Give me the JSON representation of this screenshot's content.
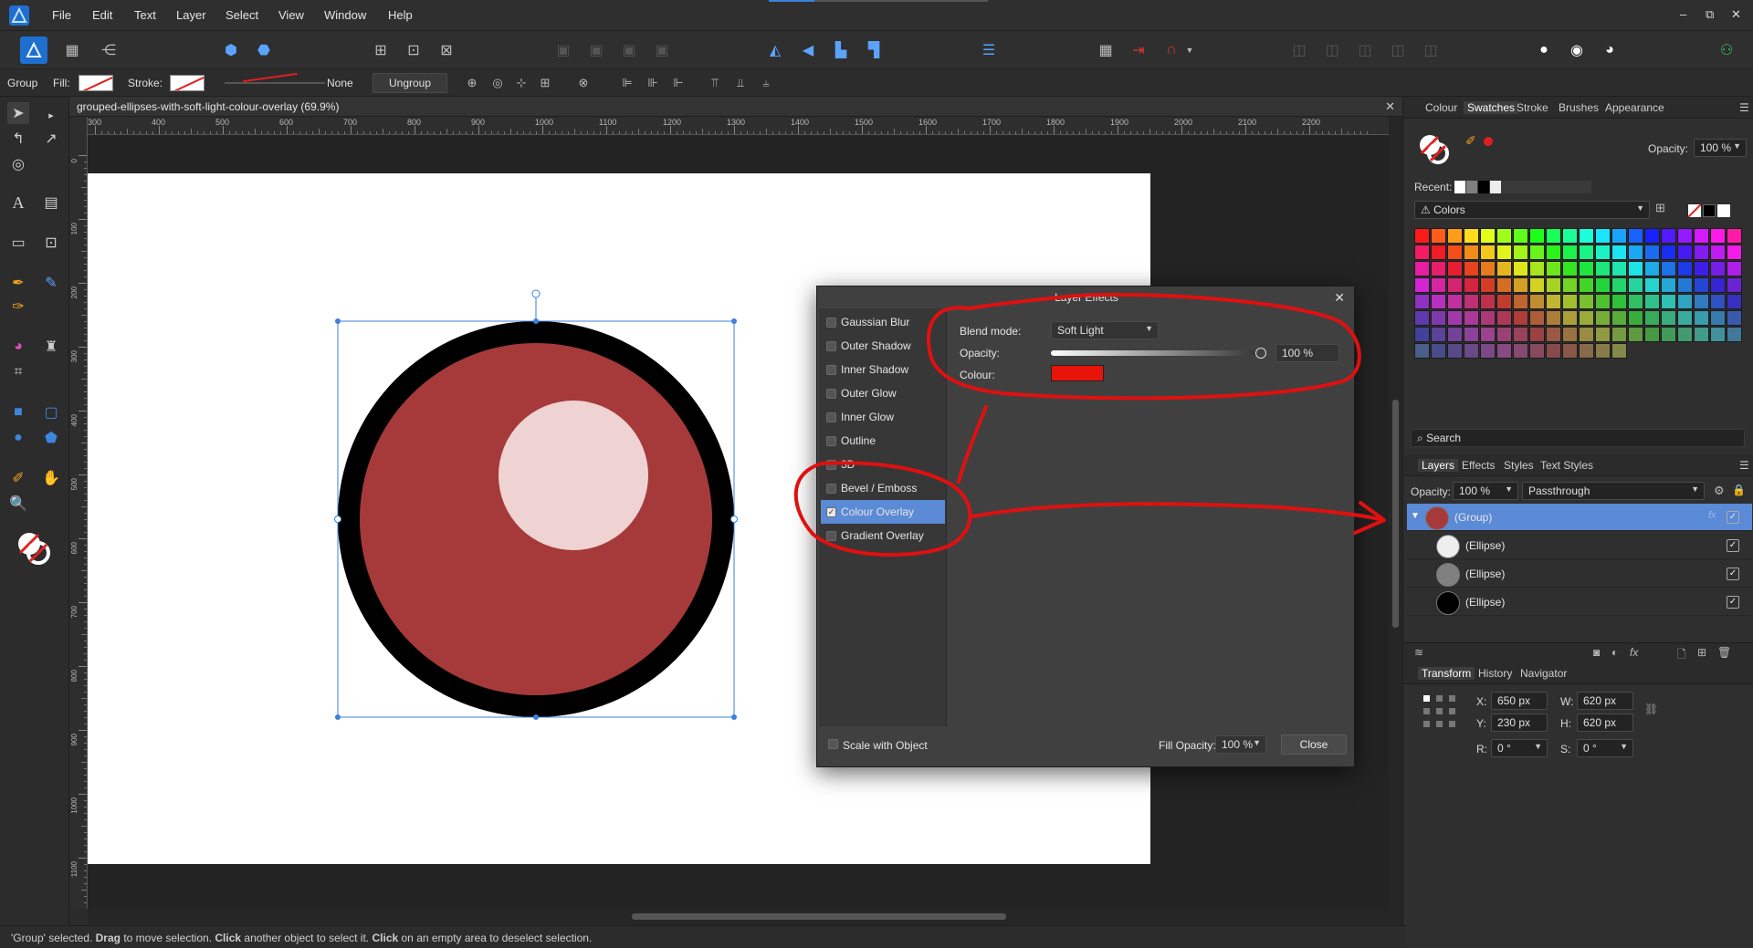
{
  "menu": {
    "items": [
      "File",
      "Edit",
      "Text",
      "Layer",
      "Select",
      "View",
      "Window",
      "Help"
    ],
    "window_controls": [
      "–",
      "⧉",
      "✕"
    ]
  },
  "context": {
    "group_label": "Group",
    "fill_label": "Fill:",
    "stroke_label": "Stroke:",
    "stroke_width": "None",
    "ungroup_label": "Ungroup"
  },
  "document": {
    "tab_title": "grouped-ellipses-with-soft-light-colour-overlay (69.9%)",
    "close": "✕"
  },
  "ruler": {
    "unit": "px",
    "h_labels": [
      "300",
      "400",
      "500",
      "600",
      "700",
      "800",
      "900",
      "1000",
      "1100",
      "1200",
      "1300",
      "1400",
      "1500",
      "1600",
      "1700",
      "1800",
      "1900",
      "2000",
      "2100",
      "2200"
    ],
    "v_labels": [
      "0",
      "100",
      "200",
      "300",
      "400",
      "500",
      "600",
      "700",
      "800",
      "900",
      "1000",
      "1100"
    ]
  },
  "dialog": {
    "title": "Layer Effects",
    "close": "✕",
    "effects": [
      {
        "label": "Gaussian Blur",
        "checked": false
      },
      {
        "label": "Outer Shadow",
        "checked": false
      },
      {
        "label": "Inner Shadow",
        "checked": false
      },
      {
        "label": "Outer Glow",
        "checked": false
      },
      {
        "label": "Inner Glow",
        "checked": false
      },
      {
        "label": "Outline",
        "checked": false
      },
      {
        "label": "3D",
        "checked": false
      },
      {
        "label": "Bevel / Emboss",
        "checked": false
      },
      {
        "label": "Colour Overlay",
        "checked": true
      },
      {
        "label": "Gradient Overlay",
        "checked": false
      }
    ],
    "blend_mode_label": "Blend mode:",
    "blend_mode_value": "Soft Light",
    "opacity_label": "Opacity:",
    "opacity_value": "100 %",
    "opacity_fraction": 1.0,
    "colour_label": "Colour:",
    "colour_value": "#e8140c",
    "scale_with_object": "Scale with Object",
    "fill_opacity_label": "Fill Opacity:",
    "fill_opacity_value": "100 %",
    "close_button": "Close"
  },
  "swatches_panel": {
    "tabs": [
      "Colour",
      "Swatches",
      "Stroke",
      "Brushes",
      "Appearance"
    ],
    "active_tab": "Swatches",
    "opacity_label": "Opacity:",
    "opacity_value": "100 %",
    "recent_label": "Recent:",
    "palette_name": "Colors",
    "search_placeholder": "Search"
  },
  "layers_panel": {
    "tabs": [
      "Layers",
      "Effects",
      "Styles",
      "Text Styles"
    ],
    "active_tab": "Layers",
    "opacity_label": "Opacity:",
    "opacity_value": "100 %",
    "blend_value": "Passthrough",
    "layers": [
      {
        "name": "(Group)",
        "selected": true,
        "thumb": "#a63a3a"
      },
      {
        "name": "(Ellipse)",
        "selected": false,
        "thumb": "#eeeeee"
      },
      {
        "name": "(Ellipse)",
        "selected": false,
        "thumb": "#808080"
      },
      {
        "name": "(Ellipse)",
        "selected": false,
        "thumb": "#000000"
      }
    ]
  },
  "transform_panel": {
    "tabs": [
      "Transform",
      "History",
      "Navigator"
    ],
    "active_tab": "Transform",
    "x_label": "X:",
    "x_value": "650 px",
    "y_label": "Y:",
    "y_value": "230 px",
    "w_label": "W:",
    "w_value": "620 px",
    "h_label": "H:",
    "h_value": "620 px",
    "r_label": "R:",
    "r_value": "0 °",
    "s_label": "S:",
    "s_value": "0 °"
  },
  "status": {
    "p1": "'Group' selected. ",
    "b1": "Drag",
    "p2": " to move selection. ",
    "b2": "Click",
    "p3": " another object to select it. ",
    "b3": "Click",
    "p4": " on an empty area to deselect selection."
  },
  "colors": {
    "outer_ring": "#000000",
    "middle_fill": "#a63a3a",
    "inner_highlight": "#efd3d3",
    "selection": "#3d7fd9",
    "annotation": "#e01010",
    "accent": "#5b8ad6"
  }
}
